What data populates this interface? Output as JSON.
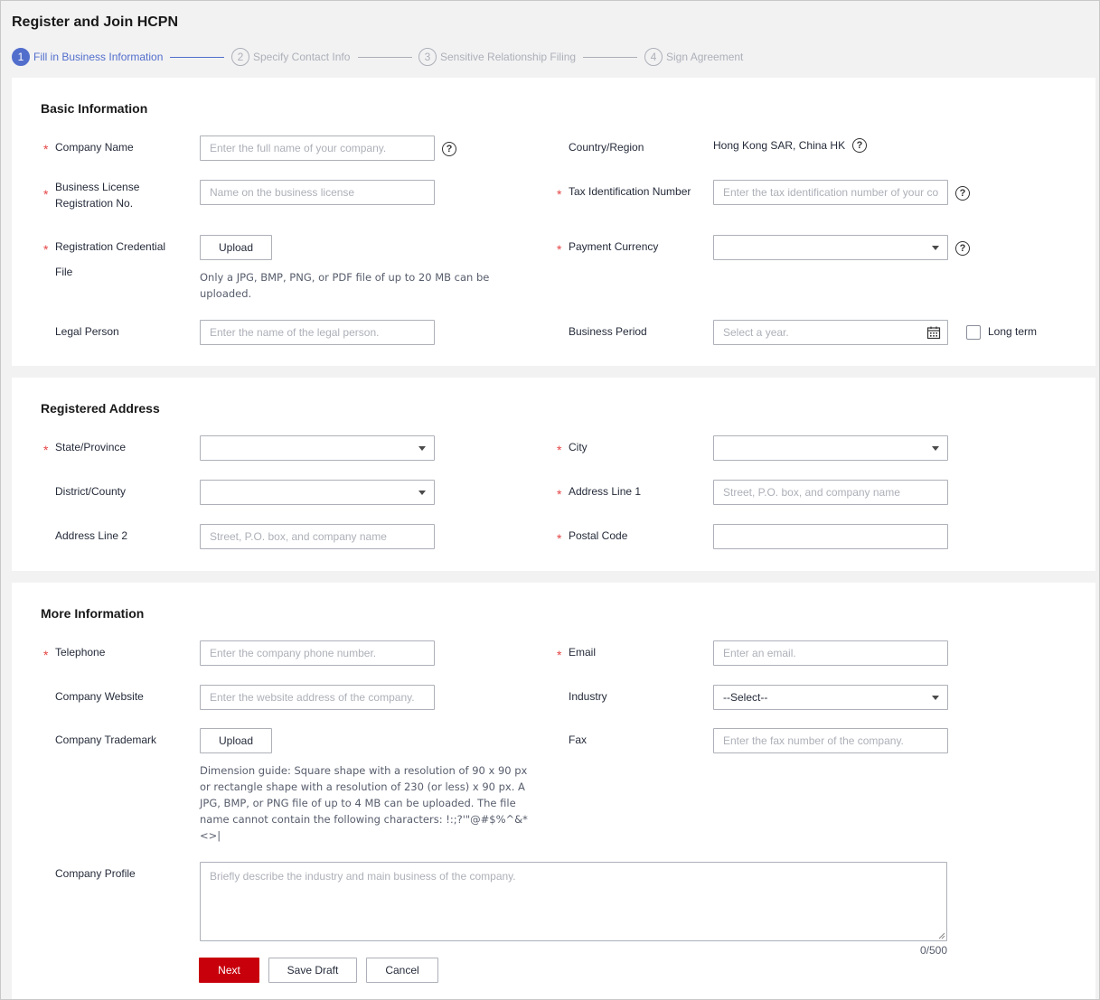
{
  "page": {
    "title": "Register and Join HCPN"
  },
  "steps": [
    {
      "num": "1",
      "label": "Fill in Business Information"
    },
    {
      "num": "2",
      "label": "Specify Contact Info"
    },
    {
      "num": "3",
      "label": "Sensitive Relationship Filing"
    },
    {
      "num": "4",
      "label": "Sign Agreement"
    }
  ],
  "basic": {
    "title": "Basic Information",
    "company_name": {
      "label": "Company Name",
      "placeholder": "Enter the full name of your company."
    },
    "country_region": {
      "label": "Country/Region",
      "value": "Hong Kong SAR, China HK"
    },
    "license_no": {
      "label_line1": "Business License",
      "label_line2": "Registration No.",
      "placeholder": "Name on the business license"
    },
    "tax_id": {
      "label": "Tax Identification Number",
      "placeholder": "Enter the tax identification number of your co"
    },
    "credential": {
      "label_line1": "Registration Credential",
      "label_line2": "File",
      "button": "Upload",
      "hint_line1": "Only a JPG, BMP, PNG, or PDF file of up to 20 MB can be",
      "hint_line2": "uploaded."
    },
    "payment_currency": {
      "label": "Payment Currency",
      "value": ""
    },
    "legal_person": {
      "label": "Legal Person",
      "placeholder": "Enter the name of the legal person."
    },
    "business_period": {
      "label": "Business Period",
      "placeholder": "Select a year.",
      "long_term": "Long term"
    }
  },
  "address": {
    "title": "Registered Address",
    "state": {
      "label": "State/Province",
      "value": ""
    },
    "city": {
      "label": "City",
      "value": ""
    },
    "district": {
      "label": "District/County",
      "value": ""
    },
    "line1": {
      "label": "Address Line 1",
      "placeholder": "Street, P.O. box, and company name"
    },
    "line2": {
      "label": "Address Line 2",
      "placeholder": "Street, P.O. box, and company name"
    },
    "postal": {
      "label": "Postal Code",
      "placeholder": ""
    }
  },
  "more": {
    "title": "More Information",
    "telephone": {
      "label": "Telephone",
      "placeholder": "Enter the company phone number."
    },
    "email": {
      "label": "Email",
      "placeholder": "Enter an email."
    },
    "website": {
      "label": "Company Website",
      "placeholder": "Enter the website address of the company."
    },
    "industry": {
      "label": "Industry",
      "value": "--Select--"
    },
    "trademark": {
      "label": "Company Trademark",
      "button": "Upload",
      "hint_lines": [
        "Dimension guide: Square shape with a resolution of 90 x 90 px",
        "or rectangle shape with a resolution of 230 (or less) x 90 px. A",
        "JPG, BMP, or PNG file of up to 4 MB can be uploaded. The file",
        "name cannot contain the following characters: !:;?'\"@#$%^&*",
        "<>|"
      ]
    },
    "fax": {
      "label": "Fax",
      "placeholder": "Enter the fax number of the company."
    },
    "profile": {
      "label": "Company Profile",
      "placeholder": "Briefly describe the industry and main business of the company.",
      "counter": "0/500"
    }
  },
  "actions": {
    "next": "Next",
    "save_draft": "Save Draft",
    "cancel": "Cancel"
  },
  "help_icon_text": "?",
  "required_mark": "*",
  "colors": {
    "primary": "#526ecc",
    "danger": "#c7000b",
    "required": "#e54545"
  }
}
